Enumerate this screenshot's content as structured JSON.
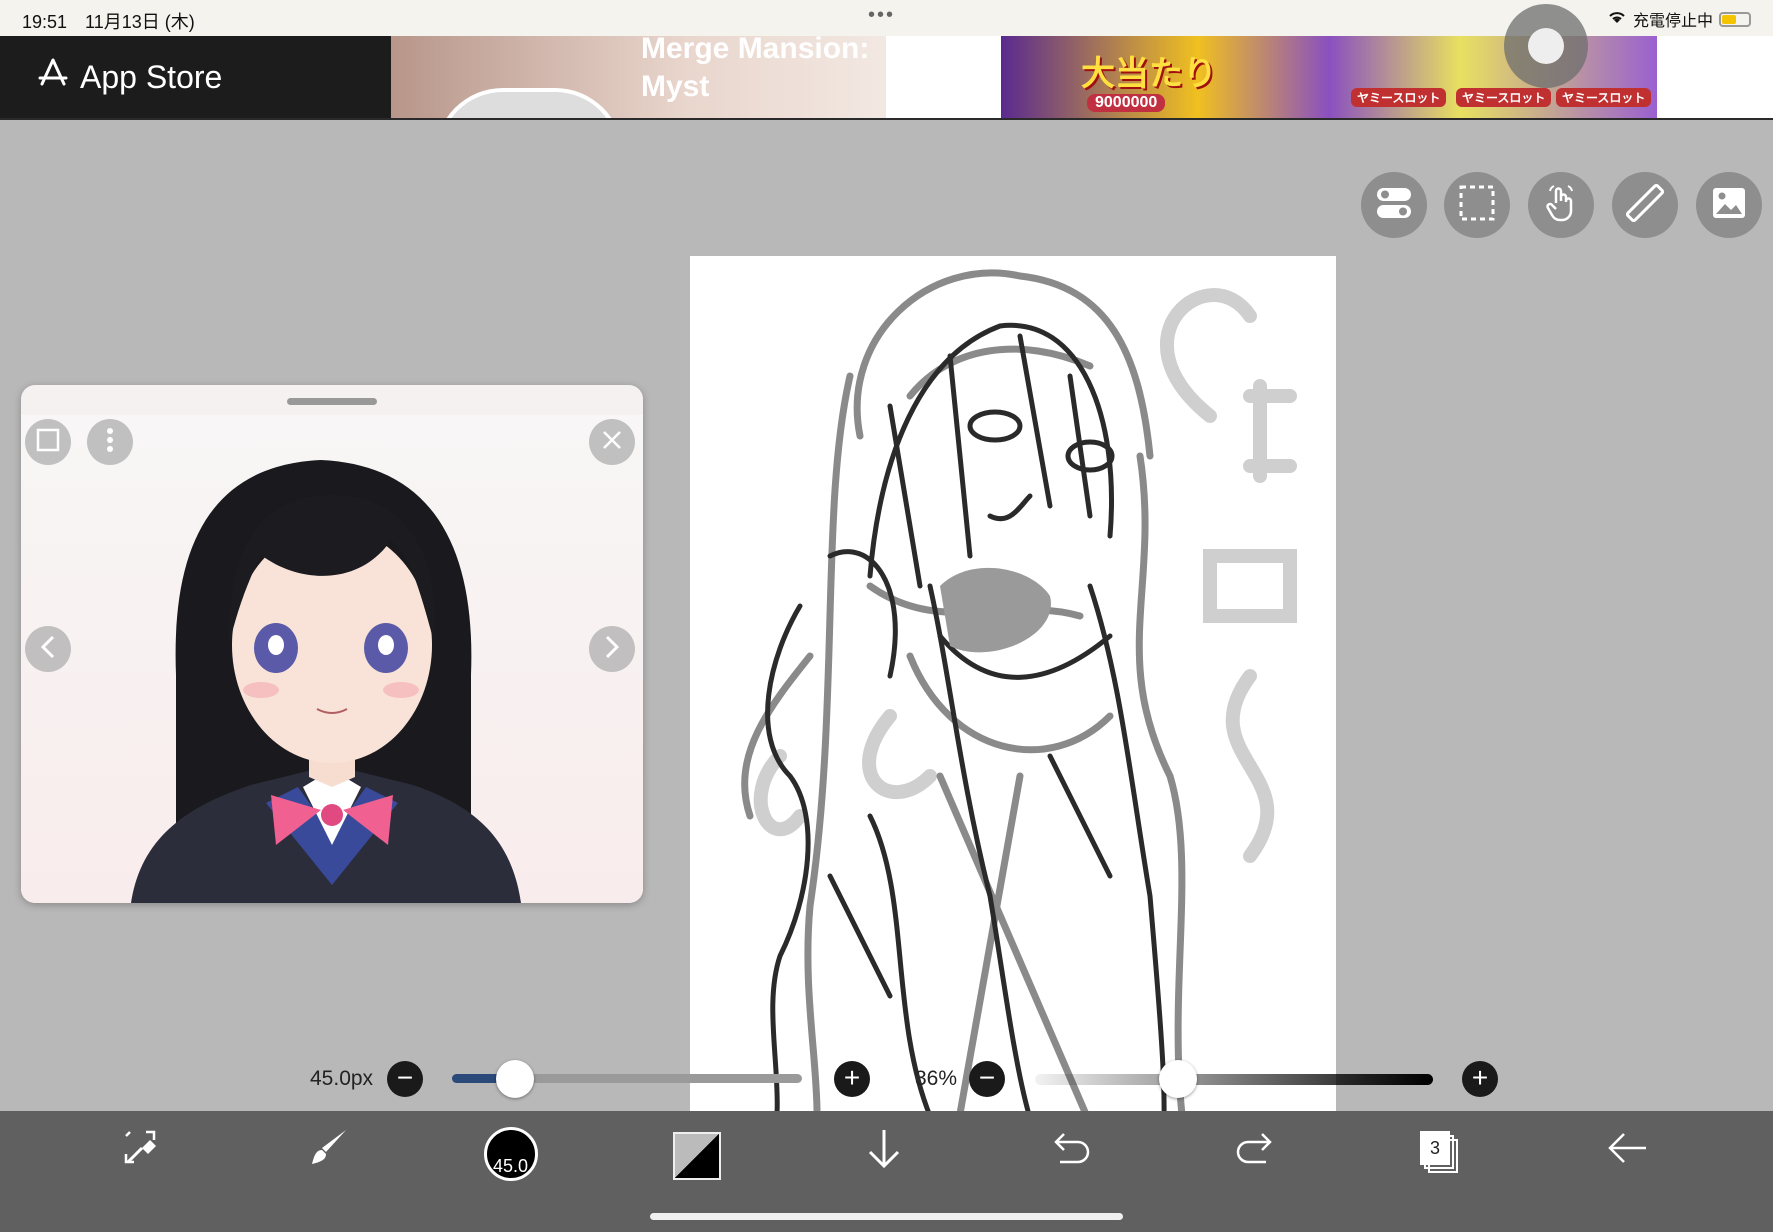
{
  "status": {
    "time": "19:51",
    "date": "11月13日 (木)",
    "dots": "•••",
    "charging": "充電停止中"
  },
  "ads": {
    "appstore_label": "App Store",
    "ad1_title": "Merge Mansion: Myst",
    "ad2_title": "大当たり",
    "ad2_number": "9000000",
    "ad2_slot": "ヤミースロット"
  },
  "tools": [
    "toggle-icon",
    "selection-icon",
    "hand-icon",
    "ruler-icon",
    "image-icon"
  ],
  "brush": {
    "size_label": "45.0px",
    "size_value": "45.0",
    "size_fraction": 0.18
  },
  "opacity": {
    "label": "36%",
    "fraction": 0.36
  },
  "layers": {
    "count": "3"
  },
  "colors": {
    "bg": "#b8b8b8",
    "bottombar": "#606060",
    "accent": "#2b4a7a"
  }
}
